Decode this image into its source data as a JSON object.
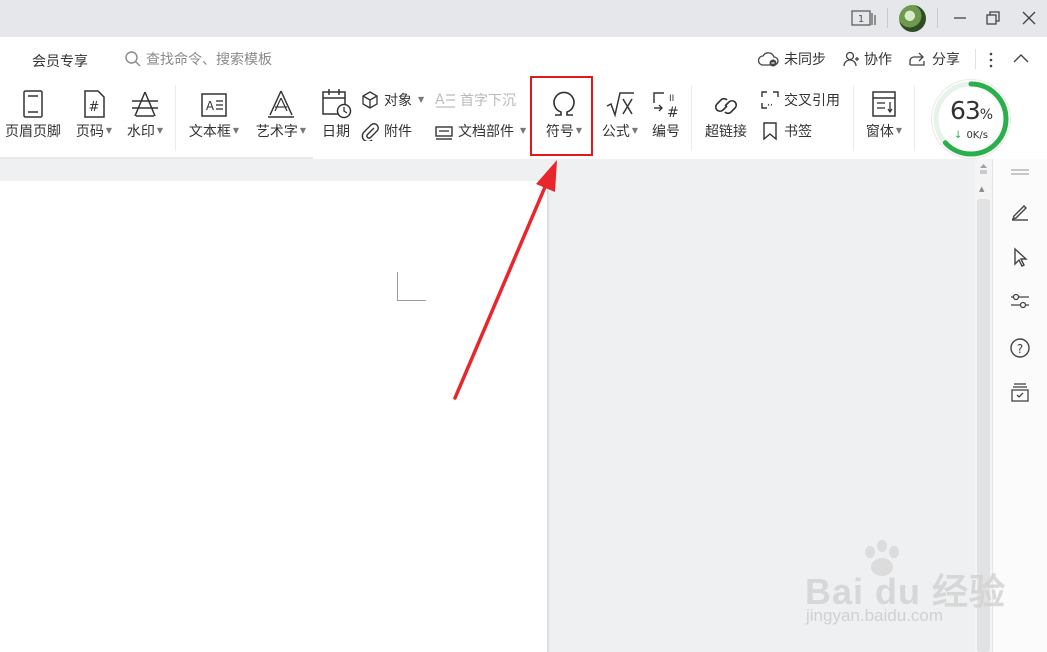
{
  "titlebar": {
    "window_count": "1",
    "minimize_icon": "minimize-icon",
    "restore_icon": "restore-icon",
    "close_icon": "close-icon"
  },
  "menu": {
    "vip_label": "会员专享",
    "search_placeholder": "查找命令、搜索模板",
    "sync_label": "未同步",
    "collab_label": "协作",
    "share_label": "分享"
  },
  "ribbon": {
    "header_footer": "页眉页脚",
    "page_number": "页码",
    "watermark": "水印",
    "text_box": "文本框",
    "word_art": "艺术字",
    "date": "日期",
    "object": "对象",
    "attachment": "附件",
    "drop_cap": "首字下沉",
    "doc_parts": "文档部件",
    "symbol": "符号",
    "formula": "公式",
    "numbering": "编号",
    "hyperlink": "超链接",
    "cross_ref": "交叉引用",
    "bookmark": "书签",
    "window": "窗体"
  },
  "speed_widget": {
    "percent": "63",
    "percent_unit": "%",
    "rate": "0K/s",
    "progress": 0.63,
    "ring_color": "#2ab04a"
  },
  "accent": {
    "highlight_color": "#e0191f"
  },
  "watermark": {
    "brand": "Bai du 经验",
    "url": "jingyan.baidu.com"
  }
}
